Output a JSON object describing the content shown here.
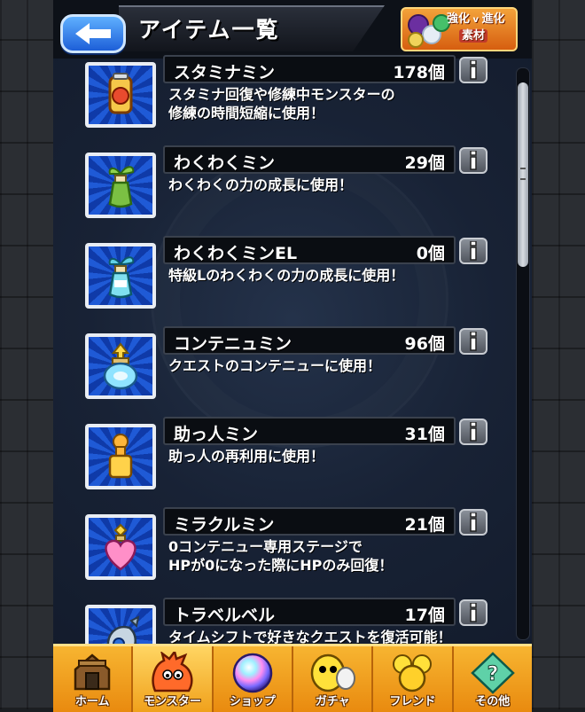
{
  "header": {
    "back_label": "",
    "title": "アイテム一覧",
    "evo_button": {
      "line1": "強化",
      "line2": "素材",
      "line1b": "進化"
    }
  },
  "items": [
    {
      "name": "スタミナミン",
      "count": "178個",
      "description": "スタミナ回復や修練中モンスターの\n修練の時間短縮に使用！",
      "icon": "stamina-can-icon",
      "accent": "#e94b2e"
    },
    {
      "name": "わくわくミン",
      "count": "29個",
      "description": "わくわくの力の成長に使用！",
      "icon": "sprout-bottle-icon",
      "accent": "#7bc043"
    },
    {
      "name": "わくわくミンEL",
      "count": "0個",
      "description": "特級Lのわくわくの力の成長に使用！",
      "icon": "sprout-bottle-el-icon",
      "accent": "#5fd1e8"
    },
    {
      "name": "コンテニュミン",
      "count": "96個",
      "description": "クエストのコンテニューに使用！",
      "icon": "continue-jar-icon",
      "accent": "#8fe3ff"
    },
    {
      "name": "助っ人ミン",
      "count": "31個",
      "description": "助っ人の再利用に使用！",
      "icon": "helper-bottle-icon",
      "accent": "#ffb63a"
    },
    {
      "name": "ミラクルミン",
      "count": "21個",
      "description": "0コンテニュー専用ステージで\nHPが0になった際にHPのみ回復！",
      "icon": "heart-potion-icon",
      "accent": "#ff8fc8"
    },
    {
      "name": "トラベルベル",
      "count": "17個",
      "description": "タイムシフトで好きなクエストを復活可能！",
      "icon": "travel-bell-icon",
      "accent": "#9fb6c9"
    }
  ],
  "tabs": [
    {
      "label": "ホーム",
      "icon": "home-icon"
    },
    {
      "label": "モンスター",
      "icon": "monster-icon"
    },
    {
      "label": "ショップ",
      "icon": "orb-icon"
    },
    {
      "label": "ガチャ",
      "icon": "gacha-icon"
    },
    {
      "label": "フレンド",
      "icon": "friends-icon"
    },
    {
      "label": "その他",
      "icon": "other-icon"
    }
  ],
  "active_tab": "モンスター",
  "colors": {
    "panel": "#182235",
    "tabbar": "#f2a124",
    "back_button": "#2f7fe8"
  }
}
